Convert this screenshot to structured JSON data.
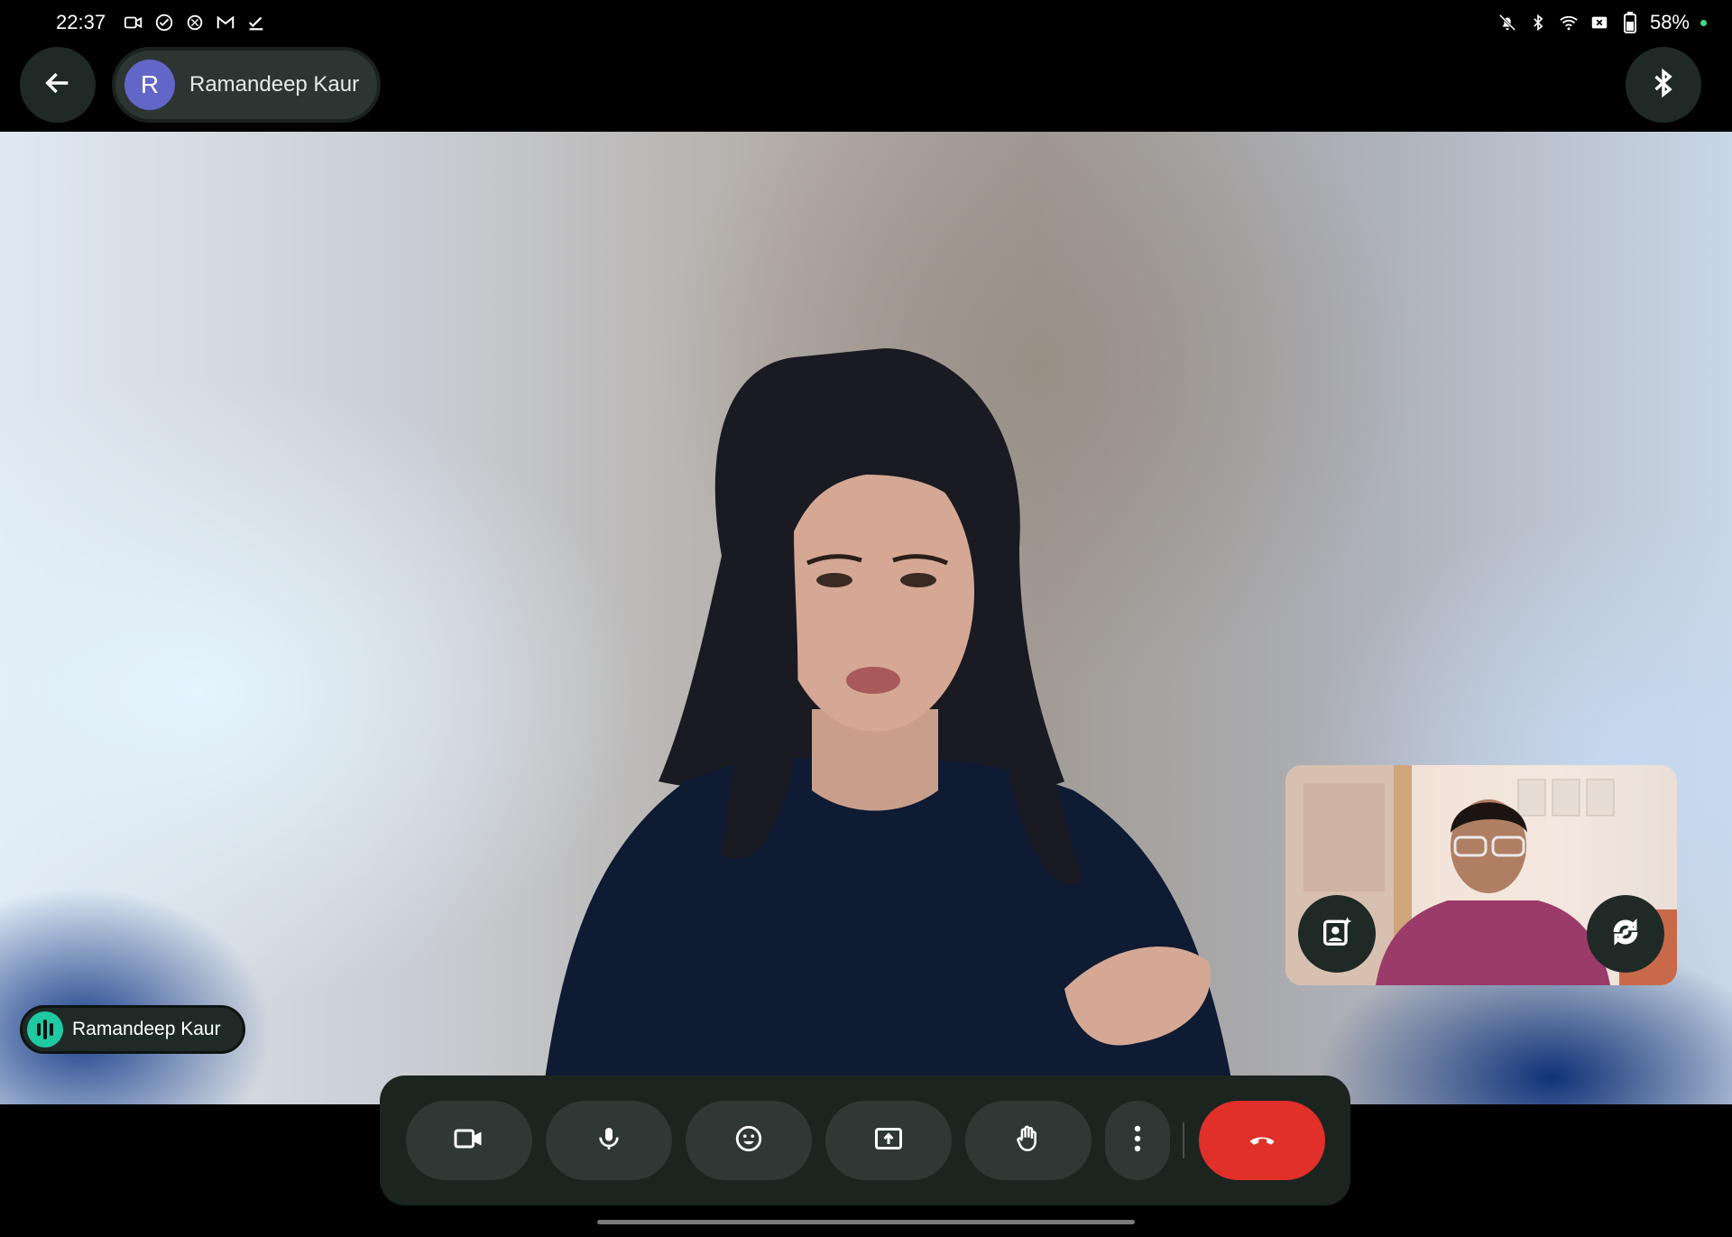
{
  "status_bar": {
    "time": "22:37",
    "left_icons": [
      "video-call-icon",
      "check-circle-icon",
      "openai-icon",
      "gmail-icon",
      "task-done-icon"
    ],
    "right_icons": [
      "bell-off-icon",
      "bluetooth-icon",
      "wifi-icon",
      "no-sim-icon",
      "battery-icon"
    ],
    "battery": "58%"
  },
  "top_bar": {
    "back_icon": "arrow-back-icon",
    "participant": {
      "initial": "R",
      "name": "Ramandeep Kaur",
      "avatar_color": "#6266c8"
    },
    "bluetooth_icon": "bluetooth-icon"
  },
  "main_video": {
    "speaker_name": "Ramandeep Kaur",
    "speaking_indicator_color": "#1fc9a2"
  },
  "self_view": {
    "left_button_icon": "portrait-effects-icon",
    "right_button_icon": "switch-camera-icon"
  },
  "controls": [
    {
      "name": "camera-button",
      "icon": "video-camera-icon"
    },
    {
      "name": "microphone-button",
      "icon": "microphone-icon"
    },
    {
      "name": "reactions-button",
      "icon": "emoji-icon"
    },
    {
      "name": "present-button",
      "icon": "present-screen-icon"
    },
    {
      "name": "raise-hand-button",
      "icon": "hand-icon"
    },
    {
      "name": "more-options-button",
      "icon": "more-vert-icon"
    },
    {
      "name": "end-call-button",
      "icon": "call-end-icon",
      "color": "#e12f2a"
    }
  ]
}
